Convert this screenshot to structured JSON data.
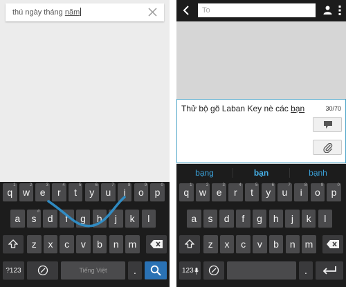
{
  "left": {
    "search": {
      "text_before": "thú ngày tháng ",
      "text_underlined": "năm"
    },
    "keyboard": {
      "row1": [
        {
          "label": "q",
          "hint": "1"
        },
        {
          "label": "w",
          "hint": "2"
        },
        {
          "label": "e",
          "hint": "3"
        },
        {
          "label": "r",
          "hint": "4"
        },
        {
          "label": "t",
          "hint": "5"
        },
        {
          "label": "y",
          "hint": "6"
        },
        {
          "label": "u",
          "hint": "7"
        },
        {
          "label": "i",
          "hint": "8"
        },
        {
          "label": "o",
          "hint": "9"
        },
        {
          "label": "p",
          "hint": "0"
        }
      ],
      "row2": [
        {
          "label": "a",
          "hint": ""
        },
        {
          "label": "s",
          "hint": "#"
        },
        {
          "label": "d",
          "hint": ""
        },
        {
          "label": "f",
          "hint": ""
        },
        {
          "label": "g",
          "hint": ""
        },
        {
          "label": "h",
          "hint": ""
        },
        {
          "label": "j",
          "hint": ""
        },
        {
          "label": "k",
          "hint": ""
        },
        {
          "label": "l",
          "hint": ""
        }
      ],
      "row3": [
        "z",
        "x",
        "c",
        "v",
        "b",
        "n",
        "m"
      ],
      "numbers_key": "?123",
      "space_label": "Tiếng Việt",
      "period_key": "."
    }
  },
  "right": {
    "to_placeholder": "To",
    "message": {
      "text_before": "Thử bộ gõ Laban Key nè các ",
      "text_underlined": "bạn"
    },
    "counter": "30/70",
    "suggestions": [
      "bạng",
      "bạn",
      "bạnh"
    ],
    "selected_suggestion_index": 1,
    "keyboard": {
      "row1": [
        {
          "label": "q",
          "hint": "1"
        },
        {
          "label": "w",
          "hint": "2"
        },
        {
          "label": "e",
          "hint": "3"
        },
        {
          "label": "r",
          "hint": "4"
        },
        {
          "label": "t",
          "hint": "5"
        },
        {
          "label": "y",
          "hint": "6"
        },
        {
          "label": "u",
          "hint": "7"
        },
        {
          "label": "i",
          "hint": "8"
        },
        {
          "label": "o",
          "hint": "9"
        },
        {
          "label": "p",
          "hint": "0"
        }
      ],
      "row2": [
        {
          "label": "a",
          "hint": ""
        },
        {
          "label": "s",
          "hint": ""
        },
        {
          "label": "d",
          "hint": ""
        },
        {
          "label": "f",
          "hint": ""
        },
        {
          "label": "g",
          "hint": ""
        },
        {
          "label": "h",
          "hint": ""
        },
        {
          "label": "j",
          "hint": ""
        },
        {
          "label": "k",
          "hint": ""
        },
        {
          "label": "l",
          "hint": ""
        }
      ],
      "row3": [
        "z",
        "x",
        "c",
        "v",
        "b",
        "n",
        "m"
      ],
      "numbers_key": "123",
      "period_key": "."
    }
  },
  "colors": {
    "keyboard_bg": "#1c1c1c",
    "key_bg": "#4a4a4c",
    "accent_blue": "#2a72b5",
    "suggestion_text": "#3aa0d8",
    "swipe_trail": "#2f8fc9"
  },
  "icons": {
    "clear": "close-icon",
    "shift": "shift-icon",
    "backspace": "backspace-icon",
    "emoji": "emoji-icon",
    "search": "search-icon",
    "back": "chevron-left-icon",
    "contact": "person-icon",
    "menu": "overflow-menu-icon",
    "send": "speech-bubble-icon",
    "attach": "paperclip-icon",
    "microphone": "microphone-icon",
    "enter": "enter-arrow-icon"
  }
}
